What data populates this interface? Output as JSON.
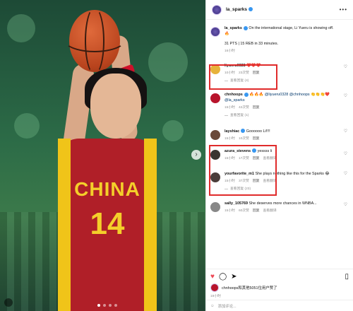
{
  "post": {
    "username": "la_sparks",
    "jersey_country": "CHINA",
    "jersey_number": "14"
  },
  "caption": {
    "username": "la_sparks",
    "text_line1": "On the international stage, Li Yueru is showing off.",
    "emoji": "🔥",
    "text_line2": "31 PTS | 15 REB in 33 minutes.",
    "time": "16小时"
  },
  "comments": [
    {
      "username": "liyueru0328",
      "text": "❤️❤️❤️",
      "time": "10小时",
      "likes": "23次赞",
      "reply": "回复",
      "view_replies": "查看回复 (4)",
      "avatar_color": "#e7b23b"
    },
    {
      "username": "chnhoops",
      "text": "🔥🔥🔥 @liyueru0328 @chnhoops 👏👏👏❤️ @la_sparks",
      "time": "15小时",
      "likes": "42次赞",
      "reply": "回复",
      "view_replies": "查看回复 (1)",
      "avatar_color": "#b8142c"
    },
    {
      "username": "layshiac",
      "text": "Goooooo Li!!!!",
      "time": "15小时",
      "likes": "10次赞",
      "reply": "回复",
      "avatar_color": "#6a4a3a"
    },
    {
      "username": "azura_stevens",
      "text": "yessss li",
      "time": "15小时",
      "likes": "17次赞",
      "reply": "回复",
      "view_translation": "查看翻译",
      "avatar_color": "#3a3530"
    },
    {
      "username": "yourfavorite_m1",
      "text": "She plays nothing like this for the Sparks 😂",
      "time": "15小时",
      "likes": "37次赞",
      "reply": "回复",
      "view_translation": "查看翻译",
      "view_replies": "查看回复 (23)",
      "avatar_color": "#4a3d3a"
    },
    {
      "username": "sally_105769",
      "text": "She deserves more chances in WNBA...",
      "time": "15小时",
      "likes": "60次赞",
      "reply": "回复",
      "view_translation": "查看翻译",
      "avatar_color": "#888888"
    }
  ],
  "footer": {
    "liked_by": "chnhoops和其他5051位用户赞了",
    "time": "19小时",
    "add_comment_placeholder": "添加评论..."
  },
  "misc": {
    "view_translation": "查看翻译"
  }
}
